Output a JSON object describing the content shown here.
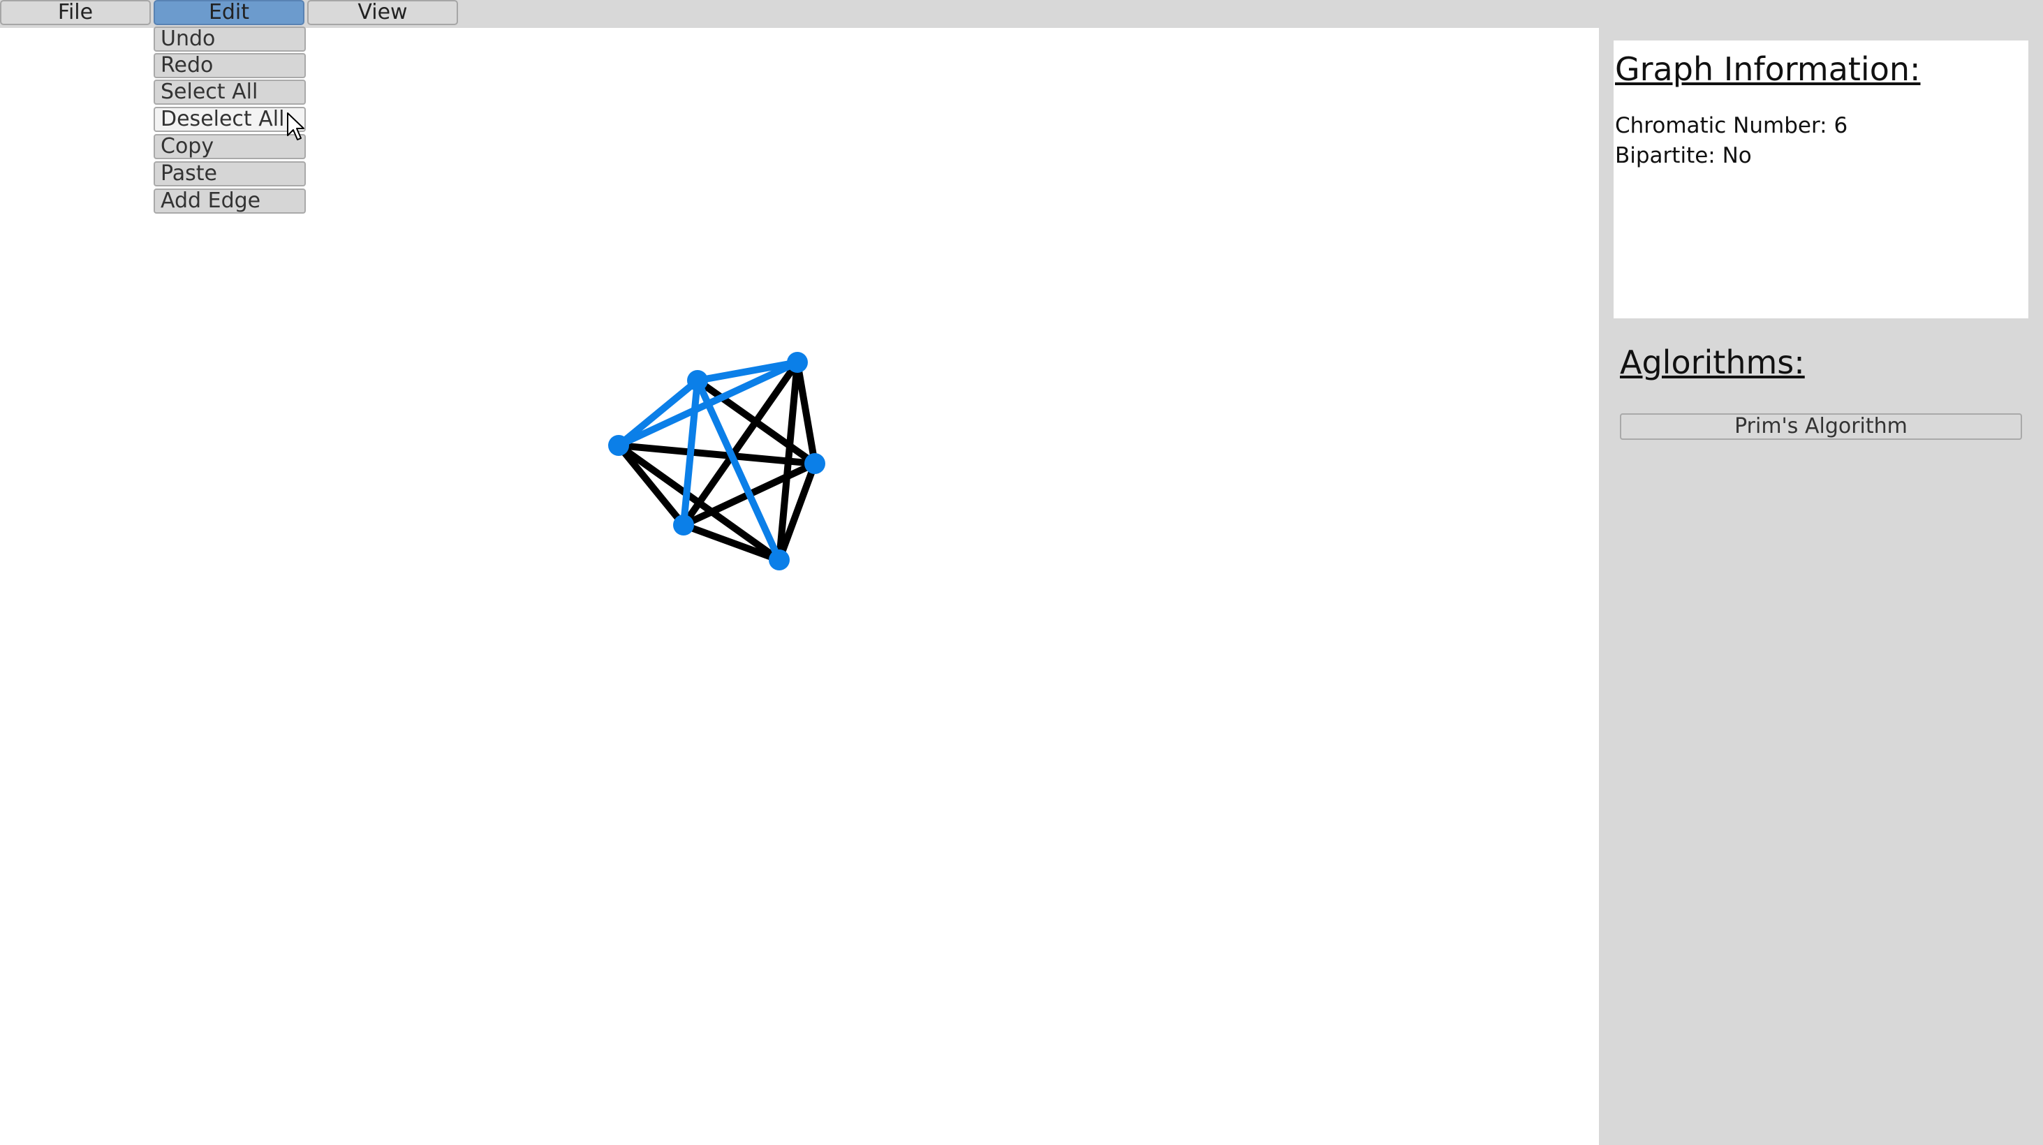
{
  "menubar": {
    "items": [
      {
        "label": "File",
        "active": false
      },
      {
        "label": "Edit",
        "active": true
      },
      {
        "label": "View",
        "active": false
      }
    ]
  },
  "edit_menu": {
    "items": [
      {
        "label": "Undo"
      },
      {
        "label": "Redo"
      },
      {
        "label": "Select All"
      },
      {
        "label": "Deselect All",
        "hovered": true
      },
      {
        "label": "Copy"
      },
      {
        "label": "Paste"
      },
      {
        "label": "Add Edge"
      }
    ]
  },
  "graph": {
    "node_color": "#0b7fe8",
    "selected_edge_color": "#0b7fe8",
    "edge_color": "#000000",
    "nodes": [
      "A",
      "B",
      "C",
      "D",
      "E",
      "F"
    ],
    "edges": [
      {
        "from": "A",
        "to": "B",
        "selected": true
      },
      {
        "from": "A",
        "to": "C",
        "selected": true
      },
      {
        "from": "A",
        "to": "D",
        "selected": false
      },
      {
        "from": "A",
        "to": "E",
        "selected": false
      },
      {
        "from": "A",
        "to": "F",
        "selected": false
      },
      {
        "from": "B",
        "to": "C",
        "selected": true
      },
      {
        "from": "B",
        "to": "D",
        "selected": false
      },
      {
        "from": "B",
        "to": "E",
        "selected": true
      },
      {
        "from": "B",
        "to": "F",
        "selected": true
      },
      {
        "from": "C",
        "to": "D",
        "selected": false
      },
      {
        "from": "C",
        "to": "E",
        "selected": false
      },
      {
        "from": "C",
        "to": "F",
        "selected": false
      },
      {
        "from": "D",
        "to": "E",
        "selected": false
      },
      {
        "from": "D",
        "to": "F",
        "selected": false
      },
      {
        "from": "E",
        "to": "F",
        "selected": false
      }
    ]
  },
  "graph_info": {
    "title": "Graph Information:",
    "chromatic_number": "Chromatic Number: 6",
    "bipartite": "Bipartite: No"
  },
  "algorithms": {
    "title": "Aglorithms:",
    "buttons": [
      {
        "label": "Prim's Algorithm"
      }
    ]
  }
}
